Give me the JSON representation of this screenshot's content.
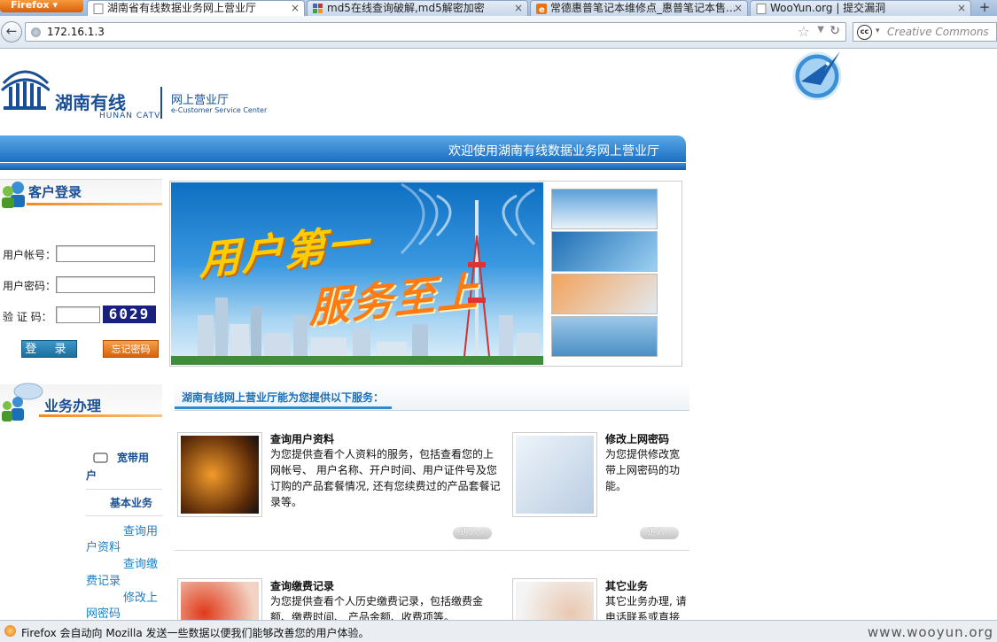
{
  "browser": {
    "menu_button": "Firefox",
    "tabs": [
      {
        "label": "湖南省有线数据业务网上营业厅",
        "active": true
      },
      {
        "label": "md5在线查询破解,md5解密加密",
        "active": false
      },
      {
        "label": "常德惠普笔记本维修点_惠普笔记本售...",
        "active": false
      },
      {
        "label": "WooYun.org | 提交漏洞",
        "active": false
      }
    ],
    "close_glyph": "×",
    "new_tab_glyph": "+",
    "url": "172.16.1.3",
    "search_placeholder": "Creative Commons",
    "cc_badge": "cc"
  },
  "header": {
    "brand_cn": "湖南有线",
    "brand_en": "HUNAN CATV",
    "service_cn": "网上营业厅",
    "service_en": "e-Customer Service Center",
    "welcome": "欢迎使用湖南有线数据业务网上营业厅"
  },
  "login": {
    "title": "客户登录",
    "account_label": "用户帐号：",
    "account_value": "",
    "password_label": "用户密码：",
    "password_value": "",
    "captcha_label": "验 证 码：",
    "captcha_value": "",
    "captcha_text": "6029",
    "login_button": "登 录",
    "forgot_button": "忘记密码"
  },
  "business": {
    "title": "业务办理",
    "broadband_line1": "宽带用",
    "broadband_line2": "户",
    "basic": "基本业务",
    "links": [
      {
        "line1": "查询用",
        "line2": "户资料"
      },
      {
        "line1": "查询缴",
        "line2": "费记录"
      },
      {
        "line1": "修改上",
        "line2": "网密码"
      }
    ]
  },
  "banner": {
    "slogan_line1": "用户第一",
    "slogan_line2": "服务至上"
  },
  "services": {
    "header": "湖南有线网上营业厅能为您提供以下服务：",
    "enter_label": "进入",
    "items": [
      {
        "title": "查询用户资料",
        "desc": "为您提供查看个人资料的服务，包括查看您的上网帐号、 用户名称、开户时间、用户证件号及您订购的产品套餐情况, 还有您续费过的产品套餐记录等。"
      },
      {
        "title": "修改上网密码",
        "desc": "为您提供修改宽带上网密码的功能。"
      },
      {
        "title": "查询缴费记录",
        "desc": "为您提供查看个人历史缴费记录，包括缴费金额、缴费时间、 产品金额、收费项等。"
      },
      {
        "title": "其它业务",
        "desc": "其它业务办理, 请电话联系或直接"
      }
    ]
  },
  "statusbar": {
    "message": "Firefox 会自动向 Mozilla 发送一些数据以便我们能够改善您的用户体验。",
    "watermark": "www.wooyun.org"
  }
}
